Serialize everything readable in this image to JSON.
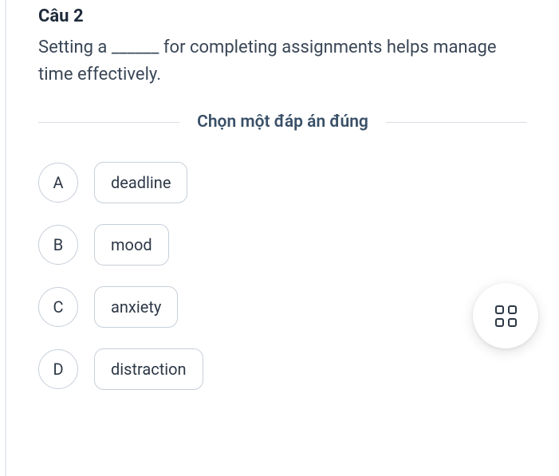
{
  "question": {
    "number_label": "Câu 2",
    "text": "Setting a ______ for completing assignments helps manage time effectively."
  },
  "instruction": "Chọn một đáp án đúng",
  "options": [
    {
      "letter": "A",
      "text": "deadline"
    },
    {
      "letter": "B",
      "text": "mood"
    },
    {
      "letter": "C",
      "text": "anxiety"
    },
    {
      "letter": "D",
      "text": "distraction"
    }
  ]
}
